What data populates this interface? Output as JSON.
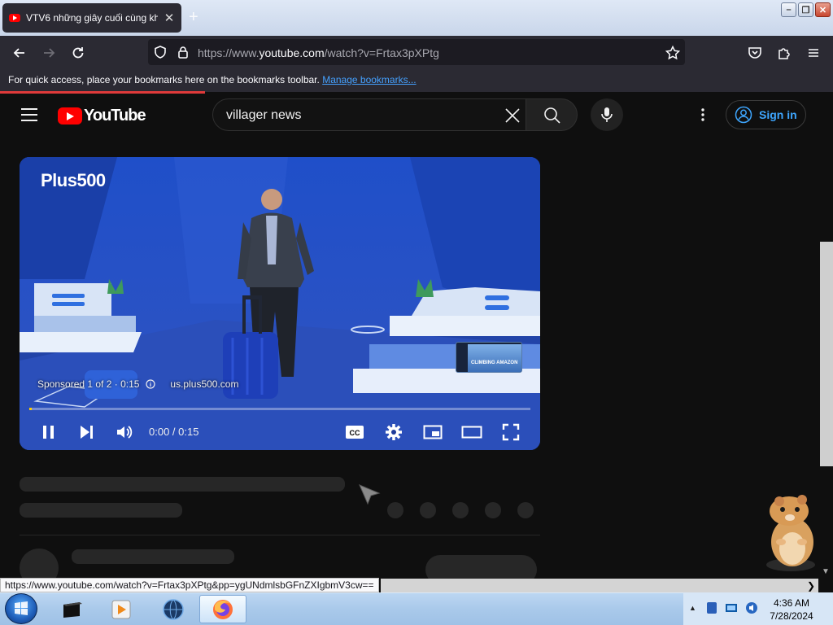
{
  "browser": {
    "tab_title": "VTV6 những giây cuối cùng kh",
    "url_prefix": "https://www.",
    "url_domain": "youtube.com",
    "url_path": "/watch?v=Frtax3pXPtg",
    "bookmarks_message": "For quick access, place your bookmarks here on the bookmarks toolbar.",
    "bookmarks_link": "Manage bookmarks...",
    "status_link": "https://www.youtube.com/watch?v=Frtax3pXPtg&pp=ygUNdmlsbGFnZXIgbmV3cw=="
  },
  "youtube": {
    "logo_text": "YouTube",
    "search_value": "villager news",
    "sign_in": "Sign in"
  },
  "player": {
    "ad_brand": "Plus500",
    "sponsored": "Sponsored 1 of 2 · 0:15",
    "ad_domain": "us.plus500.com",
    "ad_thumb_text": "CLIMBING AMAZON",
    "time": "0:00 / 0:15",
    "progress_fraction": 0.005,
    "cc_label": "CC"
  },
  "taskbar": {
    "time": "4:36 AM",
    "date": "7/28/2024"
  },
  "colors": {
    "youtube_red": "#ff0000",
    "ad_progress": "#ffcc00",
    "link_blue": "#3ea6ff"
  }
}
